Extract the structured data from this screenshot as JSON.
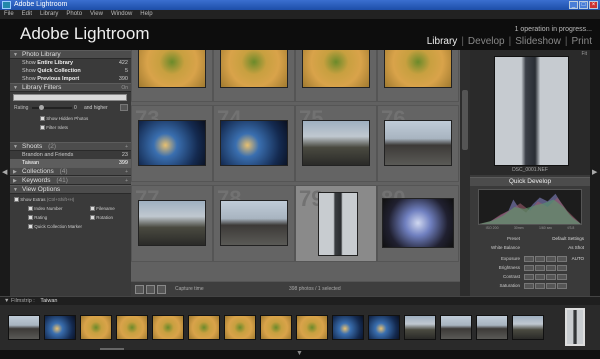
{
  "window": {
    "title": "Adobe Lightroom"
  },
  "menubar": [
    "File",
    "Edit",
    "Library",
    "Photo",
    "View",
    "Window",
    "Help"
  ],
  "identity": {
    "logo_adobe": "Adobe",
    "logo_product": "Lightroom",
    "status": "1 operation in progress..."
  },
  "modules": {
    "library": "Library",
    "develop": "Develop",
    "slideshow": "Slideshow",
    "print": "Print",
    "sep": "|"
  },
  "left_panel": {
    "photo_library": {
      "header": "Photo Library",
      "rows": [
        {
          "pre": "Show",
          "bold": "Entire Library",
          "count": "422"
        },
        {
          "pre": "Show",
          "bold": "Quick Collection",
          "count": "5"
        },
        {
          "pre": "Show",
          "bold": "Previous Import",
          "count": "390"
        }
      ]
    },
    "library_filters": {
      "header": "Library Filters",
      "header_extra": "On",
      "rating_label": "Rating",
      "rating_value": "0",
      "rating_suffix": "and higher",
      "show_hidden": "Show Hidden Photos",
      "filter_islets": "Filter Islets"
    },
    "shoots": {
      "header": "Shoots",
      "header_count": "(2)",
      "rows": [
        {
          "label": "Brandon and Friends",
          "count": "23"
        },
        {
          "label": "Taiwan",
          "count": "399"
        }
      ]
    },
    "collections": {
      "header": "Collections",
      "header_count": "(4)"
    },
    "keywords": {
      "header": "Keywords",
      "header_count": "(41)"
    },
    "view_options": {
      "header": "View Options",
      "show_extras": "Show Extras",
      "show_extras_hint": "(Ctrl+Shift+H)",
      "index_number": "Index Number",
      "filename": "Filename",
      "rating": "Rating",
      "rotation": "Rotation",
      "quick_collection_marker": "Quick Collection Marker"
    }
  },
  "grid": {
    "cells": [
      {
        "num": "",
        "thumb": "yellow"
      },
      {
        "num": "",
        "thumb": "yellow"
      },
      {
        "num": "",
        "thumb": "yellow"
      },
      {
        "num": "",
        "thumb": "yellow"
      },
      {
        "num": "73",
        "thumb": "blue"
      },
      {
        "num": "74",
        "thumb": "blue"
      },
      {
        "num": "75",
        "thumb": "street"
      },
      {
        "num": "76",
        "thumb": "city"
      },
      {
        "num": "77",
        "thumb": "street"
      },
      {
        "num": "78",
        "thumb": "city"
      },
      {
        "num": "79",
        "thumb": "tower"
      },
      {
        "num": "80",
        "thumb": "tv"
      }
    ],
    "selected_index": 10
  },
  "toolbar": {
    "sort": "Capture time",
    "info": "398 photos / 1 selected"
  },
  "right_panel": {
    "navigator_fit": "Fit",
    "navigator_caption": "DSC_0001.NEF",
    "quick_develop": {
      "header": "Quick Develop",
      "hist_labels": [
        "ISO 200",
        "30mm",
        "1/60 sec",
        "f/3.8"
      ],
      "rows": [
        {
          "label": "Preset",
          "value": "Default Settings"
        },
        {
          "label": "White Balance",
          "value": "As Shot"
        },
        {
          "label": "Exposure",
          "value": "AUTO"
        },
        {
          "label": "Brightness",
          "value": ""
        },
        {
          "label": "Contrast",
          "value": ""
        },
        {
          "label": "Saturation",
          "value": ""
        }
      ]
    }
  },
  "filmstrip": {
    "label": "Filmstrip :",
    "folder": "Taiwan"
  },
  "colors": {
    "panel_bg": "#3a3a3a",
    "grid_bg": "#616161",
    "selected_row": "#5d5d5d",
    "title_blue": "#1d4ea8"
  }
}
